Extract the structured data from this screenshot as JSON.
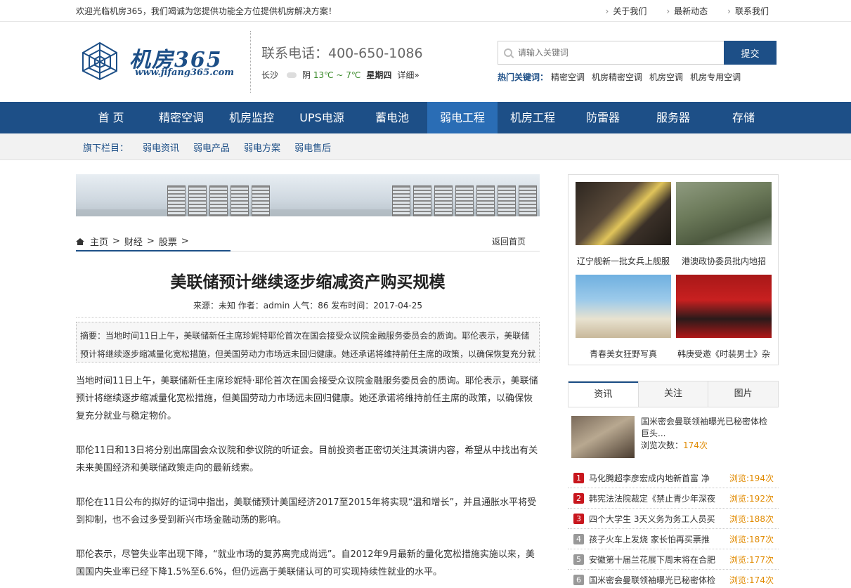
{
  "topbar": {
    "welcome": "欢迎光临机房365，我们竭诚为您提供功能全方位提供机房解决方案！",
    "links": [
      "关于我们",
      "最新动态",
      "联系我们"
    ]
  },
  "header": {
    "logo_text": "机房365",
    "logo_url": "www.jifang365.com",
    "phone": "联系电话：400-650-1086",
    "weather": {
      "city": "长沙",
      "condition": "阴",
      "temp": "13℃ ~ 7℃",
      "day": "星期四",
      "more": "详细»"
    },
    "search": {
      "placeholder": "请输入关键词",
      "button": "提交"
    },
    "hot": {
      "label": "热门关键词：",
      "keywords": [
        "精密空调",
        "机房精密空调",
        "机房空调",
        "机房专用空调"
      ]
    }
  },
  "nav": {
    "items": [
      "首 页",
      "精密空调",
      "机房监控",
      "UPS电源",
      "蓄电池",
      "弱电工程",
      "机房工程",
      "防雷器",
      "服务器",
      "存储"
    ],
    "active": "弱电工程"
  },
  "subnav": {
    "label": "旗下栏目：",
    "items": [
      "弱电资讯",
      "弱电产品",
      "弱电方案",
      "弱电售后"
    ]
  },
  "breadcrumb": {
    "items": [
      "主页",
      "财经",
      "股票"
    ],
    "back": "返回首页"
  },
  "article": {
    "title": "美联储预计继续逐步缩减资产购买规模",
    "meta": "来源：未知 作者：admin 人气：86 发布时间：2017-04-25",
    "summary": "摘要：当地时间11日上午，美联储新任主席珍妮特耶伦首次在国会接受众议院金融服务委员会的质询。耶伦表示，美联储预计将继续逐步缩减量化宽松措施，但美国劳动力市场远未回归健康。她还承诺将维持前任主席的政策，以确保恢复充分就",
    "paragraphs": [
      "当地时间11日上午，美联储新任主席珍妮特·耶伦首次在国会接受众议院金融服务委员会的质询。耶伦表示，美联储预计将继续逐步缩减量化宽松措施，但美国劳动力市场远未回归健康。她还承诺将维持前任主席的政策，以确保恢复充分就业与稳定物价。",
      "耶伦11日和13日将分别出席国会众议院和参议院的听证会。目前投资者正密切关注其演讲内容，希望从中找出有关未来美国经济和美联储政策走向的最新线索。",
      "耶伦在11日公布的拟好的证词中指出，美联储预计美国经济2017至2015年将实现“温和增长”，并且通胀水平将受到抑制，也不会过多受到新兴市场金融动荡的影响。",
      "耶伦表示，尽管失业率出现下降，“就业市场的复苏离完成尚远”。自2012年9月最新的量化宽松措施实施以来，美国国内失业率已经下降1.5%至6.6%，但仍远高于美联储认可的可实现持续性就业的水平。"
    ]
  },
  "sidebar": {
    "pics": [
      {
        "caption": "辽宁舰新一批女兵上舰服"
      },
      {
        "caption": "港澳政协委员批内地招"
      },
      {
        "caption": "青春美女狂野写真"
      },
      {
        "caption": "韩庚受邀《时装男士》杂"
      }
    ],
    "tabs": [
      "资讯",
      "关注",
      "图片"
    ],
    "feature": {
      "title": "国米密会曼联领袖曝光已秘密体检 巨头...",
      "views_label": "浏览次数：",
      "views": "174次"
    },
    "rank": [
      {
        "num": "1",
        "title": "马化腾超李彦宏成内地新首富 净",
        "views": "浏览:194次",
        "color": "#c8161d"
      },
      {
        "num": "2",
        "title": "韩宪法法院裁定《禁止青少年深夜",
        "views": "浏览:192次",
        "color": "#c8161d"
      },
      {
        "num": "3",
        "title": "四个大学生 3天义务为务工人员买",
        "views": "浏览:188次",
        "color": "#c8161d"
      },
      {
        "num": "4",
        "title": "孩子火车上发烧 家长怕再买票推",
        "views": "浏览:187次",
        "color": "#999999"
      },
      {
        "num": "5",
        "title": "安徽第十届兰花展下周末将在合肥",
        "views": "浏览:177次",
        "color": "#999999"
      },
      {
        "num": "6",
        "title": "国米密会曼联领袖曝光已秘密体检",
        "views": "浏览:174次",
        "color": "#999999"
      }
    ]
  },
  "colors": {
    "primary": "#1d4f87",
    "nav_active": "#2a6db5",
    "highlight": "#e08a00",
    "rank_top": "#c8161d"
  }
}
